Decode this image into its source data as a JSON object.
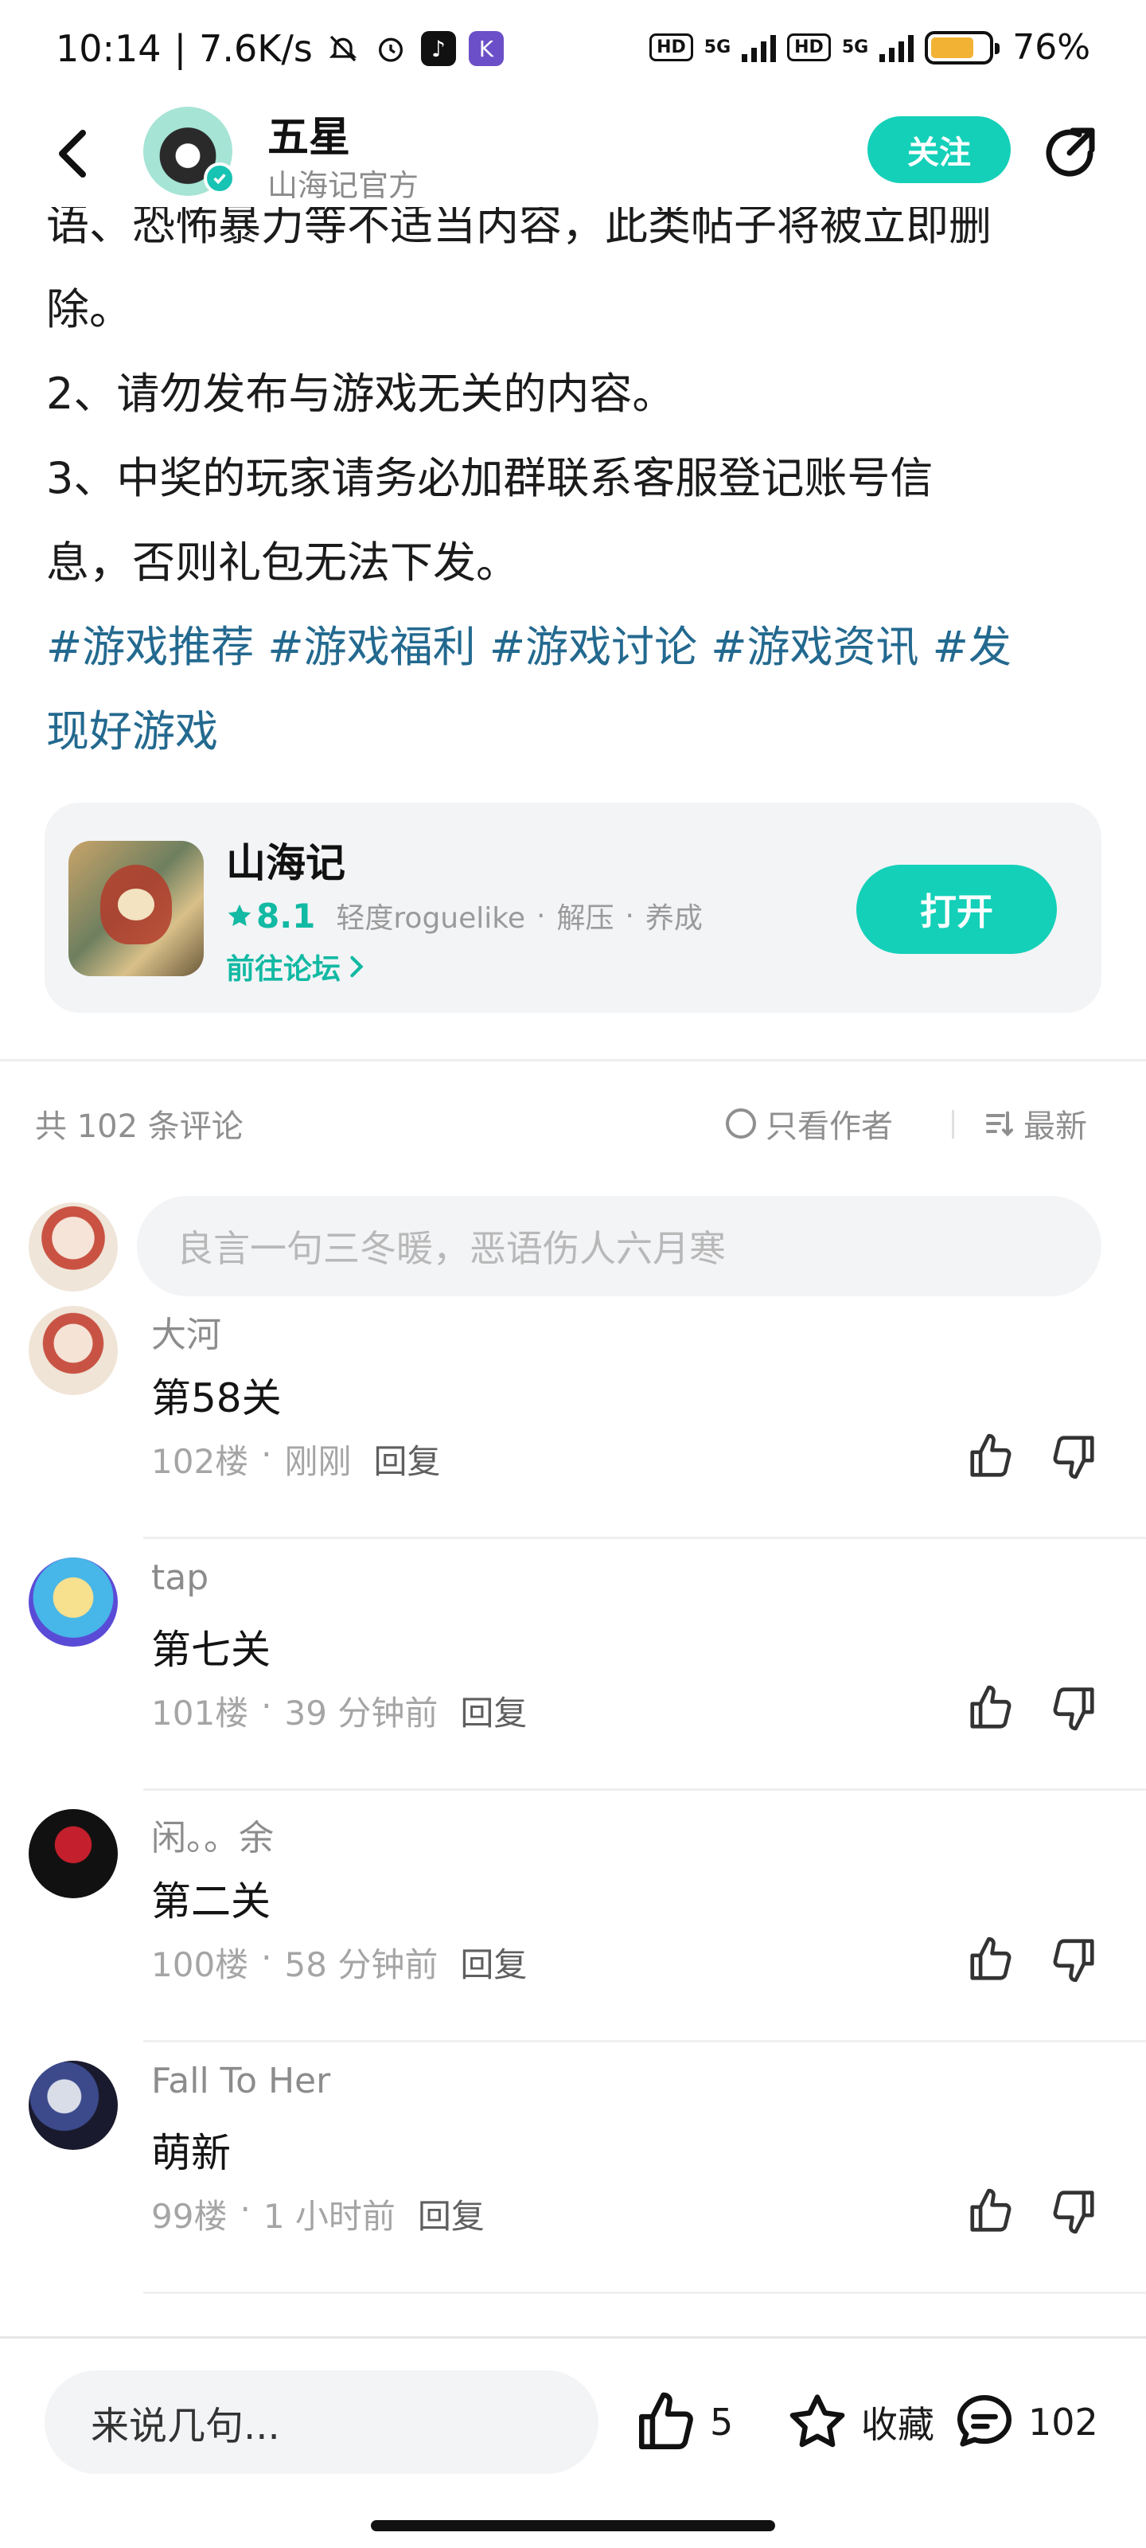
{
  "status_bar": {
    "time": "10:14",
    "network_speed": "7.6K/s",
    "hd_label": "HD",
    "sig_label": "5G",
    "battery_percent": "76%",
    "battery_level": 0.76
  },
  "header": {
    "name": "五星",
    "subtitle": "山海记官方",
    "follow_label": "关注"
  },
  "article": {
    "lines": [
      "语、恐怖暴力等不适当内容，此类帖子将被立即删",
      "除。",
      "2、请勿发布与游戏无关的内容。",
      "3、中奖的玩家请务必加群联系客服登记账号信",
      "息，否则礼包无法下发。"
    ],
    "tags_line1": "#游戏推荐 #游戏福利 #游戏讨论 #游戏资讯 #发",
    "tags_line2": "现好游戏"
  },
  "game_card": {
    "title": "山海记",
    "rating": "8.1",
    "tag1": "轻度roguelike",
    "tag2": "解压",
    "tag3": "养成",
    "dot": "·",
    "forum_link": "前往论坛",
    "open_label": "打开"
  },
  "comments_header": {
    "count_label": "共 102 条评论",
    "only_author": "只看作者",
    "sort_label": "最新"
  },
  "comment_input": {
    "placeholder": "良言一句三冬暖，恶语伤人六月寒"
  },
  "comments": [
    {
      "author": "大河",
      "text": "第58关",
      "floor": "102楼",
      "time": "刚刚",
      "reply": "回复"
    },
    {
      "author": "tap",
      "text": "第七关",
      "floor": "101楼",
      "time": "39 分钟前",
      "reply": "回复"
    },
    {
      "author": "闲。。余",
      "text": "第二关",
      "floor": "100楼",
      "time": "58 分钟前",
      "reply": "回复"
    },
    {
      "author": "Fall To Her",
      "text": "萌新",
      "floor": "99楼",
      "time": "1 小时前",
      "reply": "回复"
    }
  ],
  "meta_sep": "·",
  "bottom_bar": {
    "input_placeholder": "来说几句...",
    "like_count": "5",
    "favorite_label": "收藏",
    "comment_count": "102"
  },
  "colors": {
    "accent": "#14d0b8",
    "tag_blue": "#23698f",
    "muted": "#8f8f8f"
  },
  "icons": [
    "back-arrow-icon",
    "share-icon",
    "verified-icon",
    "star-icon",
    "chevron-right-icon",
    "thumb-up-icon",
    "thumb-down-icon",
    "favorite-star-icon",
    "comment-bubble-icon",
    "sort-icon"
  ]
}
